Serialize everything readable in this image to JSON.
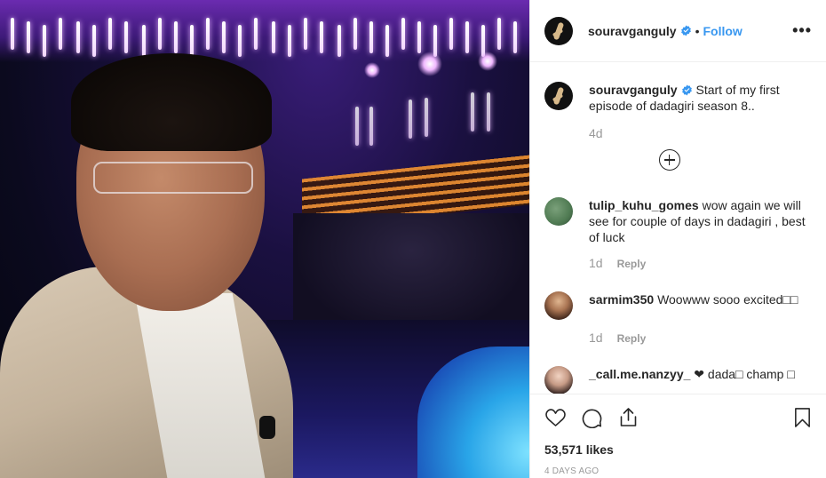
{
  "post": {
    "username": "souravganguly",
    "verified": true,
    "follow_label": "Follow",
    "more_label": "•••",
    "caption": "Start of my first episode of dadagiri season 8..",
    "caption_age": "4d",
    "likes": "53,571 likes",
    "posted_ago": "4 DAYS AGO"
  },
  "comments": [
    {
      "user": "tulip_kuhu_gomes",
      "text": "wow again we will see for couple of days in dadagiri , best of luck",
      "age": "1d",
      "reply": "Reply"
    },
    {
      "user": "sarmim350",
      "text": "Woowww sooo excited□□",
      "age": "1d",
      "reply": "Reply"
    },
    {
      "user": "_call.me.nanzyy_",
      "text": "❤ dada□ champ □"
    }
  ],
  "icons": {
    "like": "heart-icon",
    "comment": "comment-icon",
    "share": "share-icon",
    "save": "bookmark-icon",
    "verified": "verified-badge-icon",
    "load_more": "plus-circle-icon"
  },
  "colors": {
    "link_blue": "#3897f0",
    "text": "#262626",
    "muted": "#999999",
    "border": "#efefef"
  }
}
